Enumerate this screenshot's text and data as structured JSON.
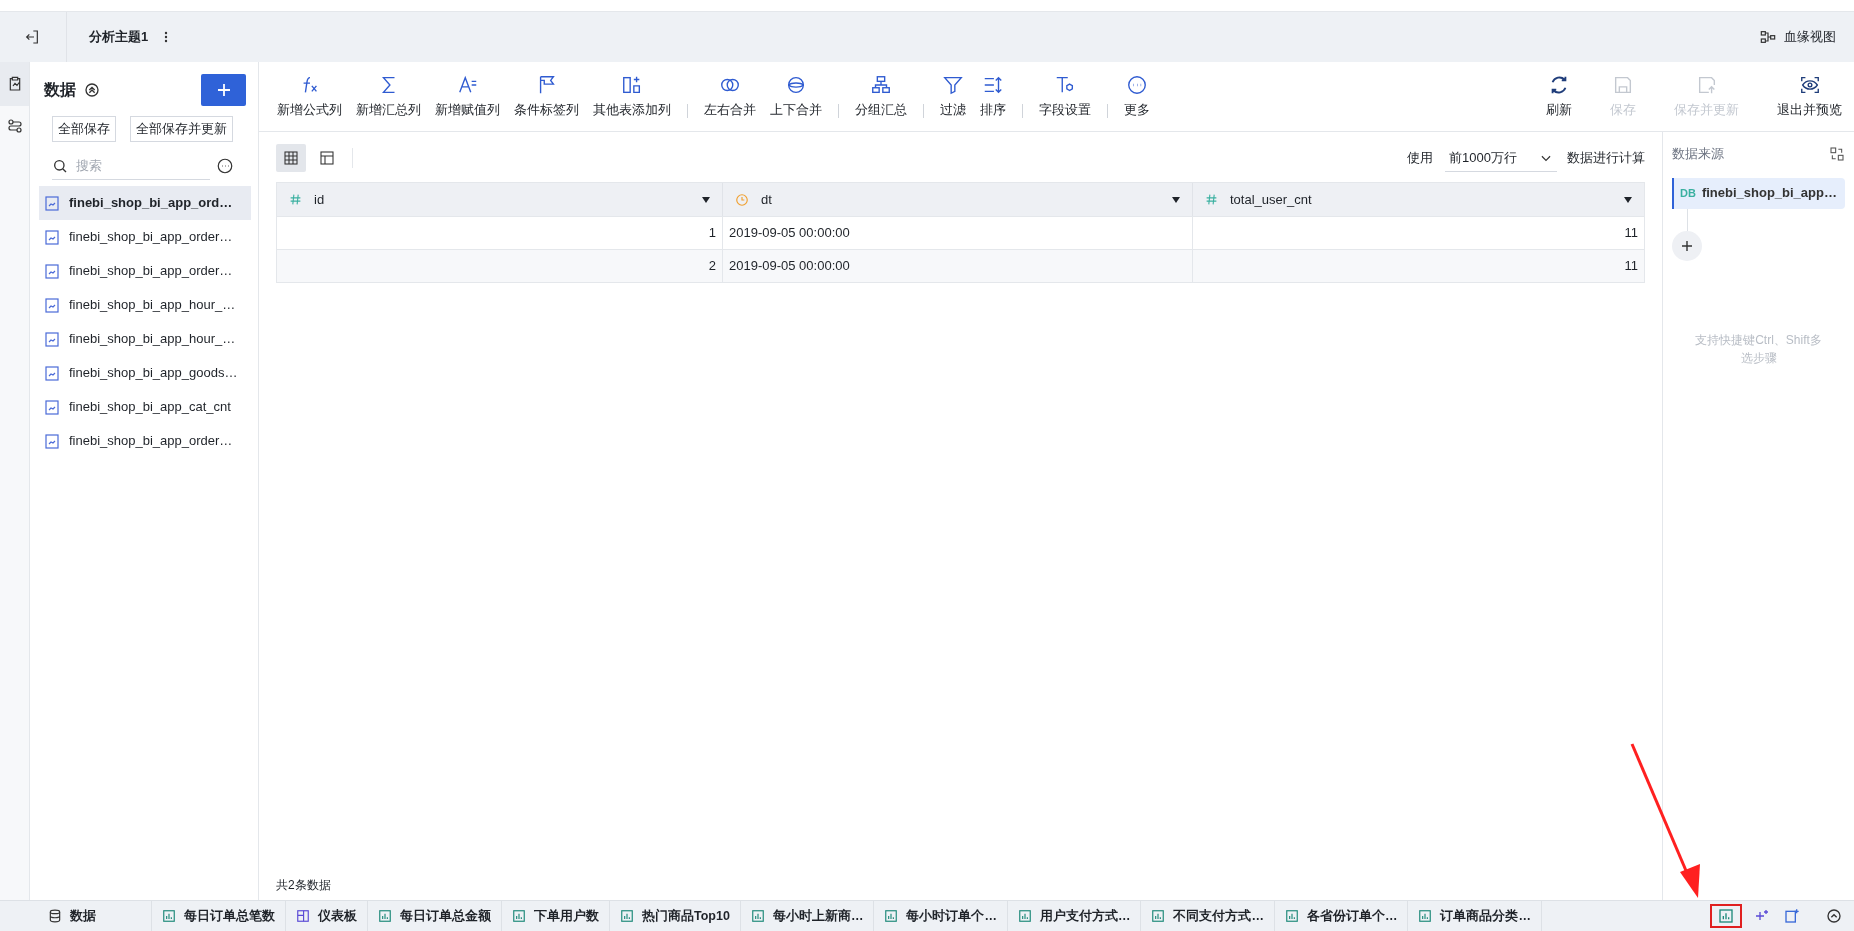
{
  "header": {
    "title": "分析主题1",
    "lineage": "血缘视图"
  },
  "data_panel": {
    "title": "数据",
    "save_all": "全部保存",
    "save_all_update": "全部保存并更新",
    "search_placeholder": "搜索",
    "items": [
      {
        "label": "finebi_shop_bi_app_ord…",
        "selected": true
      },
      {
        "label": "finebi_shop_bi_app_order…",
        "selected": false
      },
      {
        "label": "finebi_shop_bi_app_order…",
        "selected": false
      },
      {
        "label": "finebi_shop_bi_app_hour_…",
        "selected": false
      },
      {
        "label": "finebi_shop_bi_app_hour_…",
        "selected": false
      },
      {
        "label": "finebi_shop_bi_app_goods…",
        "selected": false
      },
      {
        "label": "finebi_shop_bi_app_cat_cnt",
        "selected": false
      },
      {
        "label": "finebi_shop_bi_app_order…",
        "selected": false
      }
    ]
  },
  "toolbar": {
    "groups": [
      [
        {
          "kind": "formula",
          "label": "新增公式列",
          "disabled": false
        },
        {
          "kind": "sum",
          "label": "新增汇总列",
          "disabled": false
        },
        {
          "kind": "assign",
          "label": "新增赋值列",
          "disabled": false
        },
        {
          "kind": "flag",
          "label": "条件标签列",
          "disabled": false
        },
        {
          "kind": "addcol",
          "label": "其他表添加列",
          "disabled": false
        }
      ],
      [
        {
          "kind": "lrmerge",
          "label": "左右合并",
          "disabled": false
        },
        {
          "kind": "udmerge",
          "label": "上下合并",
          "disabled": false
        }
      ],
      [
        {
          "kind": "group",
          "label": "分组汇总",
          "disabled": false
        }
      ],
      [
        {
          "kind": "filter",
          "label": "过滤",
          "disabled": false
        },
        {
          "kind": "sort",
          "label": "排序",
          "disabled": false
        }
      ],
      [
        {
          "kind": "field",
          "label": "字段设置",
          "disabled": false
        }
      ],
      [
        {
          "kind": "more",
          "label": "更多",
          "disabled": false
        }
      ]
    ],
    "right": [
      {
        "kind": "refresh",
        "label": "刷新",
        "disabled": false
      },
      {
        "kind": "save",
        "label": "保存",
        "disabled": true
      },
      {
        "kind": "saveupdate",
        "label": "保存并更新",
        "disabled": true
      },
      {
        "kind": "preview",
        "label": "退出并预览",
        "disabled": false
      }
    ]
  },
  "view_toggle": [
    {
      "kind": "grid",
      "selected": true
    },
    {
      "kind": "layout",
      "selected": false
    }
  ],
  "row_limit": {
    "prefix": "使用",
    "value": "前1000万行",
    "suffix": "数据进行计算"
  },
  "table": {
    "columns": [
      {
        "name": "id",
        "kind": "number"
      },
      {
        "name": "dt",
        "kind": "date"
      },
      {
        "name": "total_user_cnt",
        "kind": "number"
      }
    ],
    "rows": [
      [
        "1",
        "2019-09-05 00:00:00",
        "11"
      ],
      [
        "2",
        "2019-09-05 00:00:00",
        "11"
      ]
    ],
    "footer": "共2条数据"
  },
  "steps": {
    "title": "数据来源",
    "items": [
      {
        "badge": "DB",
        "label": "finebi_shop_bi_app…",
        "selected": true
      }
    ],
    "hint": "支持快捷键Ctrl、Shift多选步骤"
  },
  "bottom_tabs": [
    {
      "label": "数据",
      "kind": "data",
      "selected": false
    },
    {
      "label": "每日订单总笔数",
      "kind": "component",
      "selected": false
    },
    {
      "label": "仪表板",
      "kind": "dashboard",
      "selected": false
    },
    {
      "label": "每日订单总金额",
      "kind": "component",
      "selected": false
    },
    {
      "label": "下单用户数",
      "kind": "component",
      "selected": false
    },
    {
      "label": "热门商品Top10",
      "kind": "component",
      "selected": false
    },
    {
      "label": "每小时上新商…",
      "kind": "component",
      "selected": false
    },
    {
      "label": "每小时订单个…",
      "kind": "component",
      "selected": false
    },
    {
      "label": "用户支付方式…",
      "kind": "component",
      "selected": false
    },
    {
      "label": "不同支付方式…",
      "kind": "component",
      "selected": false
    },
    {
      "label": "各省份订单个…",
      "kind": "component",
      "selected": false
    },
    {
      "label": "订单商品分类…",
      "kind": "component",
      "selected": false
    }
  ]
}
